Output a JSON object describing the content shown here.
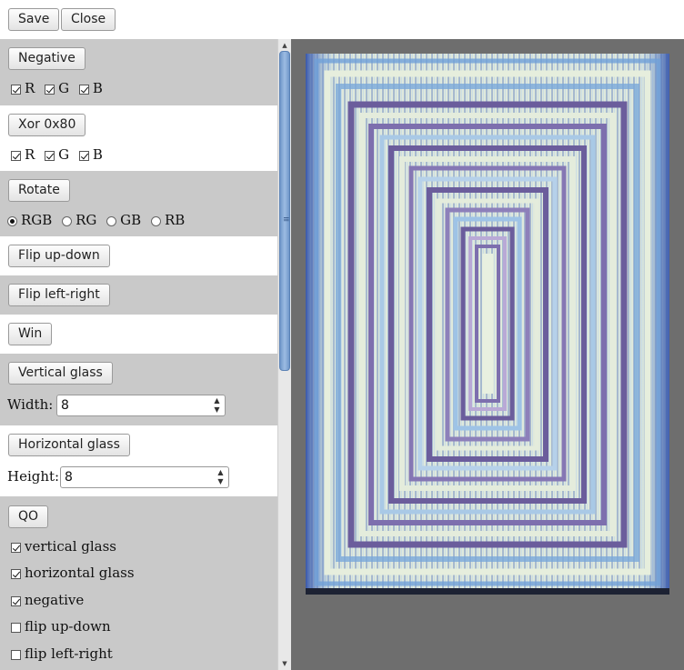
{
  "toolbar": {
    "save": "Save",
    "close": "Close"
  },
  "sections": {
    "negative": {
      "button": "Negative",
      "channels": [
        {
          "label": "R",
          "checked": true
        },
        {
          "label": "G",
          "checked": true
        },
        {
          "label": "B",
          "checked": true
        }
      ]
    },
    "xor": {
      "button": "Xor 0x80",
      "channels": [
        {
          "label": "R",
          "checked": true
        },
        {
          "label": "G",
          "checked": true
        },
        {
          "label": "B",
          "checked": true
        }
      ]
    },
    "rotate": {
      "button": "Rotate",
      "options": [
        {
          "label": "RGB",
          "selected": true
        },
        {
          "label": "RG",
          "selected": false
        },
        {
          "label": "GB",
          "selected": false
        },
        {
          "label": "RB",
          "selected": false
        }
      ]
    },
    "flip_ud": {
      "button": "Flip up-down"
    },
    "flip_lr": {
      "button": "Flip left-right"
    },
    "win": {
      "button": "Win"
    },
    "vglass": {
      "button": "Vertical glass",
      "field_label": "Width:",
      "value": "8"
    },
    "hglass": {
      "button": "Horizontal glass",
      "field_label": "Height:",
      "value": "8"
    },
    "qo": {
      "button": "QO",
      "checks": [
        {
          "label": "vertical glass",
          "checked": true
        },
        {
          "label": "horizontal glass",
          "checked": true
        },
        {
          "label": "negative",
          "checked": true
        },
        {
          "label": "flip up-down",
          "checked": false
        },
        {
          "label": "flip left-right",
          "checked": false
        }
      ]
    }
  },
  "icons": {
    "scroll_up": "arrow-up-icon",
    "scroll_down": "arrow-down-icon",
    "grip": "grip-icon"
  },
  "colors": {
    "panel_gray": "#c9c9c9",
    "viewer_bg": "#6e6e6e",
    "scroll_thumb": "#7fa3d3",
    "art_bg": "#e4ecdc",
    "art_dark": "#6b5d9c",
    "art_blue": "#2f4fa8",
    "art_light_blue": "#9ec3e6"
  }
}
